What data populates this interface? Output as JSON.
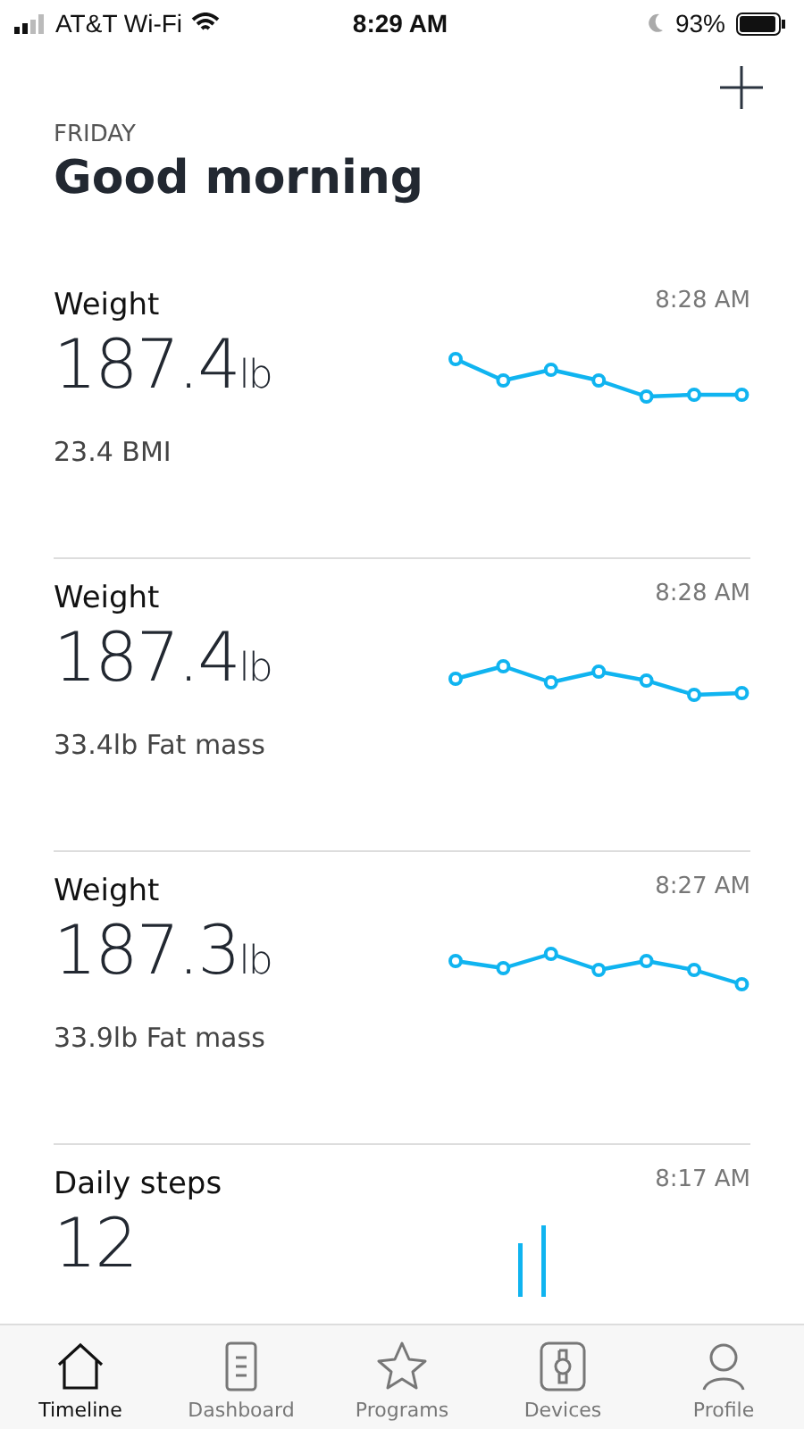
{
  "status_bar": {
    "carrier": "AT&T Wi-Fi",
    "time": "8:29 AM",
    "battery": "93%"
  },
  "header": {
    "day": "FRIDAY",
    "greeting": "Good morning"
  },
  "cards": [
    {
      "kind": "sparkline",
      "title": "Weight",
      "time": "8:28 AM",
      "value": "187.4",
      "unit": "lb",
      "detail": "23.4 BMI"
    },
    {
      "kind": "sparkline",
      "title": "Weight",
      "time": "8:28 AM",
      "value": "187.4",
      "unit": "lb",
      "detail": "33.4lb Fat mass"
    },
    {
      "kind": "sparkline",
      "title": "Weight",
      "time": "8:27 AM",
      "value": "187.3",
      "unit": "lb",
      "detail": "33.9lb Fat mass"
    },
    {
      "kind": "bars",
      "title": "Daily steps",
      "time": "8:17 AM",
      "value": "12"
    }
  ],
  "tabs": [
    {
      "label": "Timeline",
      "selected": true
    },
    {
      "label": "Dashboard",
      "selected": false
    },
    {
      "label": "Programs",
      "selected": false
    },
    {
      "label": "Devices",
      "selected": false
    },
    {
      "label": "Profile",
      "selected": false
    }
  ]
}
